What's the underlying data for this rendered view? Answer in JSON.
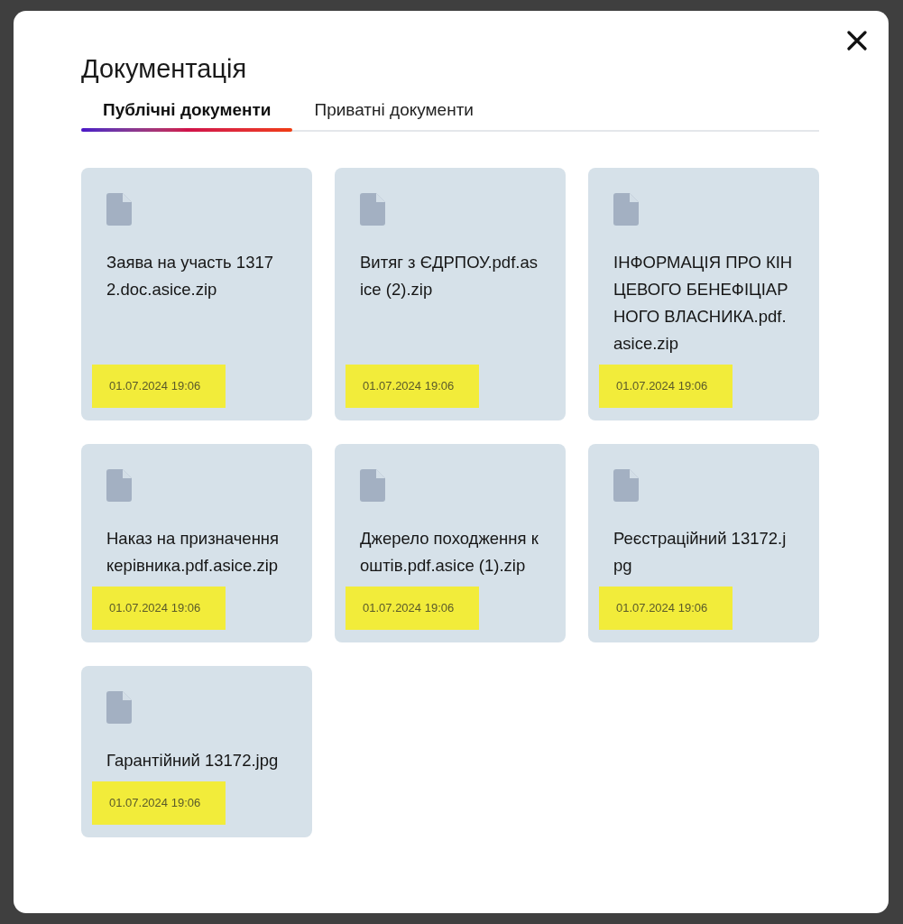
{
  "dialog": {
    "title": "Документація"
  },
  "tabs": [
    {
      "label": "Публічні документи",
      "selected": true
    },
    {
      "label": "Приватні документи",
      "selected": false
    }
  ],
  "documents": [
    {
      "name": "Заява на участь 13172.doc.asice.zip",
      "date": "01.07.2024 19:06"
    },
    {
      "name": "Витяг з ЄДРПОУ.pdf.asice (2).zip",
      "date": "01.07.2024 19:06"
    },
    {
      "name": "ІНФОРМАЦІЯ ПРО КІНЦЕВОГО БЕНЕФІЦІАРНОГО ВЛАСНИКА.pdf.asice.zip",
      "date": "01.07.2024 19:06"
    },
    {
      "name": "Наказ на призначення керівника.pdf.asice.zip",
      "date": "01.07.2024 19:06"
    },
    {
      "name": "Джерело походження коштів.pdf.asice (1).zip",
      "date": "01.07.2024 19:06"
    },
    {
      "name": "Реєстраційний 13172.jpg",
      "date": "01.07.2024 19:06"
    },
    {
      "name": "Гарантійний 13172.jpg",
      "date": "01.07.2024 19:06"
    }
  ]
}
